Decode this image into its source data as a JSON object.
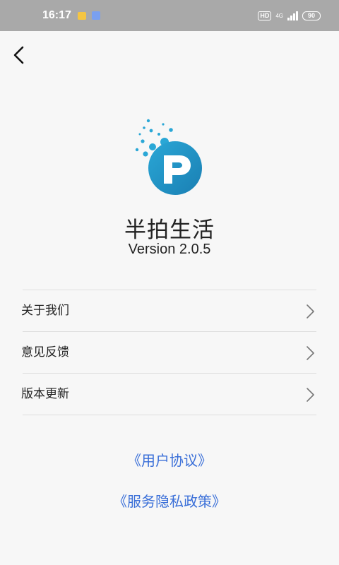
{
  "status_bar": {
    "time": "16:17",
    "hd_label": "HD",
    "network_label": "4G",
    "battery_level": "90"
  },
  "header": {
    "back_icon": "chevron-left-icon"
  },
  "app": {
    "logo_letter": "P",
    "name": "半拍生活",
    "version": "Version 2.0.5",
    "brand_color": "#1f8ec0"
  },
  "menu": {
    "items": [
      {
        "label": "关于我们",
        "icon": "chevron-right-icon"
      },
      {
        "label": "意见反馈",
        "icon": "chevron-right-icon"
      },
      {
        "label": "版本更新",
        "icon": "chevron-right-icon"
      }
    ]
  },
  "links": {
    "user_agreement": "《用户协议》",
    "privacy_policy": "《服务隐私政策》",
    "color": "#3a6fd8"
  }
}
